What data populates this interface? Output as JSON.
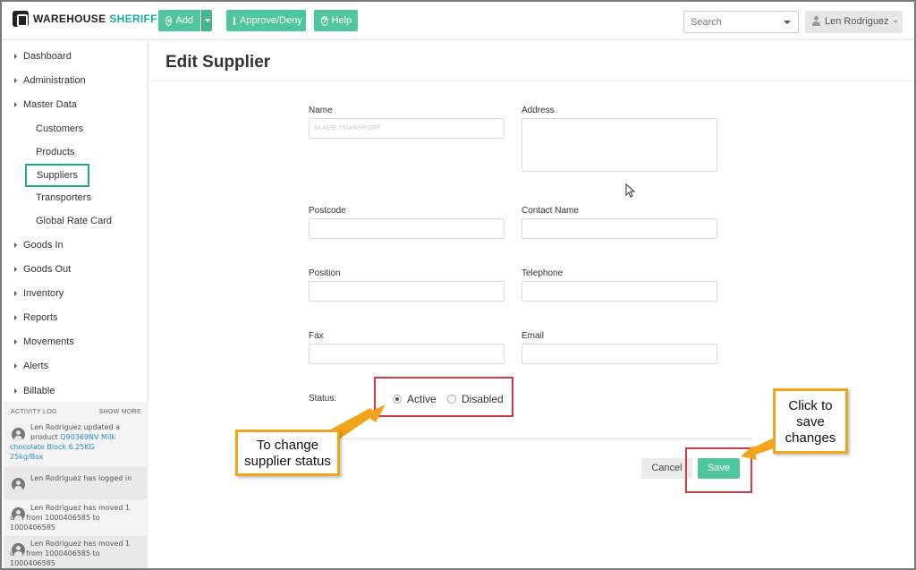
{
  "brand": {
    "word1": "WAREHOUSE",
    "word2": "SHERIFF"
  },
  "toolbar": {
    "add_label": "Add",
    "approve_label": "Approve/Deny",
    "help_label": "Help"
  },
  "header": {
    "search_placeholder": "Search",
    "user_name": "Len Rodriguez"
  },
  "sidebar": {
    "items": [
      {
        "label": "Dashboard"
      },
      {
        "label": "Administration"
      },
      {
        "label": "Master Data"
      },
      {
        "label": "Goods In"
      },
      {
        "label": "Goods Out"
      },
      {
        "label": "Inventory"
      },
      {
        "label": "Reports"
      },
      {
        "label": "Movements"
      },
      {
        "label": "Alerts"
      },
      {
        "label": "Billable"
      }
    ],
    "master_data_items": [
      {
        "label": "Customers"
      },
      {
        "label": "Products"
      },
      {
        "label": "Suppliers",
        "active": true
      },
      {
        "label": "Transporters"
      },
      {
        "label": "Global Rate Card"
      }
    ]
  },
  "activity_log": {
    "title": "ACTIVITY LOG",
    "show_more": "SHOW MORE",
    "entries": [
      {
        "line1_who": "Len Rodriguez",
        "line1_rest": "updated a",
        "line2_pre": "product ",
        "line2_link": "Q90369NV Milk",
        "line3": "chocolate Block 6.25KG",
        "line4": "25kg/Box"
      },
      {
        "line1_who": "Len Rodriguez",
        "line1_rest": "has logged in"
      },
      {
        "line1_who": "Len Rodriguez",
        "line1_rest": "has moved 1",
        "line2": "unit from 1000406585 to",
        "line3": "1000406585"
      },
      {
        "line1_who": "Len Rodriguez",
        "line1_rest": "has moved 1",
        "line2": "unit from 1000406585 to",
        "line3": "1000406585"
      }
    ]
  },
  "page": {
    "title": "Edit Supplier"
  },
  "form": {
    "name_label": "Name",
    "name_value": "BLADE TRANSPORT",
    "address_label": "Address",
    "postcode_label": "Postcode",
    "contact_label": "Contact Name",
    "position_label": "Position",
    "telephone_label": "Telephone",
    "fax_label": "Fax",
    "email_label": "Email",
    "status_label": "Status:",
    "status_options": [
      "Active",
      "Disabled"
    ],
    "status_selected": "Active",
    "cancel_label": "Cancel",
    "save_label": "Save"
  },
  "annotations": {
    "status_callout_line1": "To change",
    "status_callout_line2": "supplier status",
    "save_callout_line1": "Click to",
    "save_callout_line2": "save",
    "save_callout_line3": "changes"
  },
  "colors": {
    "accent": "#4fc69c",
    "highlight": "#d43a45",
    "callout": "#f2a51b",
    "active_nav": "#20a98a"
  }
}
